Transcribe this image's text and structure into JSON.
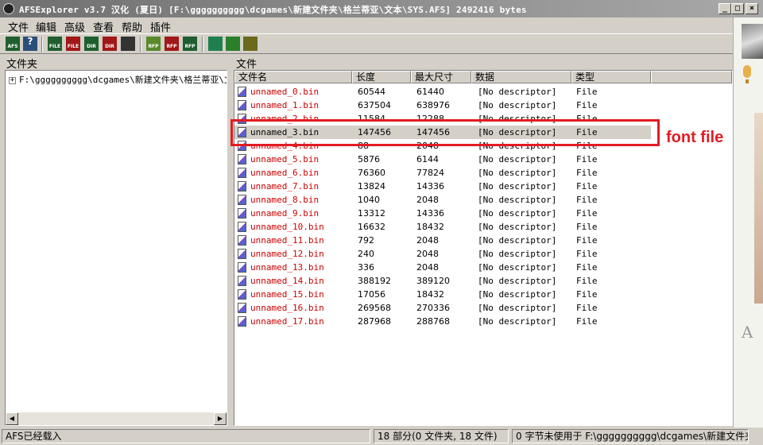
{
  "window": {
    "title": "AFSExplorer v3.7  汉化 (夏日) [F:\\gggggggggg\\dcgames\\新建文件夹\\格兰蒂亚\\文本\\SYS.AFS] 2492416 bytes",
    "min_glyph": "_",
    "max_glyph": "□",
    "close_glyph": "×"
  },
  "menu": [
    "文件",
    "编辑",
    "高级",
    "查看",
    "帮助",
    "插件"
  ],
  "toolbar": [
    {
      "icon": "afs-open-icon",
      "caption": "AFS",
      "color": "#1f5f2f"
    },
    {
      "icon": "help-icon",
      "caption": "?",
      "color": "#2a4f7a"
    },
    {
      "icon": "file-extract-icon",
      "caption": "FILE",
      "color": "#1f5f2f"
    },
    {
      "icon": "file-import-icon",
      "caption": "FILE",
      "color": "#a01818"
    },
    {
      "icon": "dir-extract-icon",
      "caption": "DIR",
      "color": "#1f5f2f"
    },
    {
      "icon": "dir-import-icon",
      "caption": "DIR",
      "color": "#a01818"
    },
    {
      "icon": "binoculars-icon",
      "caption": "",
      "color": "#333333"
    },
    {
      "icon": "rfp-build-icon",
      "caption": "RFP",
      "color": "#5a8a2a"
    },
    {
      "icon": "rfp-extract-icon",
      "caption": "RFP",
      "color": "#a01818"
    },
    {
      "icon": "rfp-import-icon",
      "caption": "RFP",
      "color": "#1f5f2f"
    },
    {
      "icon": "diamond-icon",
      "caption": "",
      "color": "#1f7f4f"
    },
    {
      "icon": "waveform-icon",
      "caption": "",
      "color": "#2a7f2a"
    },
    {
      "icon": "edit-icon",
      "caption": "",
      "color": "#6a6a1a"
    }
  ],
  "left_pane": {
    "label": "文件夹",
    "tree_item": "F:\\gggggggggg\\dcgames\\新建文件夹\\格兰蒂亚\\文",
    "expander": "+"
  },
  "right_pane": {
    "label": "文件",
    "columns": [
      "文件名",
      "长度",
      "最大尺寸",
      "数据",
      "类型"
    ],
    "rows": [
      {
        "name": "unnamed_0.bin",
        "length": "60544",
        "max": "61440",
        "data": "[No descriptor]",
        "type": "File"
      },
      {
        "name": "unnamed_1.bin",
        "length": "637504",
        "max": "638976",
        "data": "[No descriptor]",
        "type": "File"
      },
      {
        "name": "unnamed_2.bin",
        "length": "11584",
        "max": "12288",
        "data": "[No descriptor]",
        "type": "File"
      },
      {
        "name": "unnamed_3.bin",
        "length": "147456",
        "max": "147456",
        "data": "[No descriptor]",
        "type": "File"
      },
      {
        "name": "unnamed_4.bin",
        "length": "88",
        "max": "2048",
        "data": "[No descriptor]",
        "type": "File"
      },
      {
        "name": "unnamed_5.bin",
        "length": "5876",
        "max": "6144",
        "data": "[No descriptor]",
        "type": "File"
      },
      {
        "name": "unnamed_6.bin",
        "length": "76360",
        "max": "77824",
        "data": "[No descriptor]",
        "type": "File"
      },
      {
        "name": "unnamed_7.bin",
        "length": "13824",
        "max": "14336",
        "data": "[No descriptor]",
        "type": "File"
      },
      {
        "name": "unnamed_8.bin",
        "length": "1040",
        "max": "2048",
        "data": "[No descriptor]",
        "type": "File"
      },
      {
        "name": "unnamed_9.bin",
        "length": "13312",
        "max": "14336",
        "data": "[No descriptor]",
        "type": "File"
      },
      {
        "name": "unnamed_10.bin",
        "length": "16632",
        "max": "18432",
        "data": "[No descriptor]",
        "type": "File"
      },
      {
        "name": "unnamed_11.bin",
        "length": "792",
        "max": "2048",
        "data": "[No descriptor]",
        "type": "File"
      },
      {
        "name": "unnamed_12.bin",
        "length": "240",
        "max": "2048",
        "data": "[No descriptor]",
        "type": "File"
      },
      {
        "name": "unnamed_13.bin",
        "length": "336",
        "max": "2048",
        "data": "[No descriptor]",
        "type": "File"
      },
      {
        "name": "unnamed_14.bin",
        "length": "388192",
        "max": "389120",
        "data": "[No descriptor]",
        "type": "File"
      },
      {
        "name": "unnamed_15.bin",
        "length": "17056",
        "max": "18432",
        "data": "[No descriptor]",
        "type": "File"
      },
      {
        "name": "unnamed_16.bin",
        "length": "269568",
        "max": "270336",
        "data": "[No descriptor]",
        "type": "File"
      },
      {
        "name": "unnamed_17.bin",
        "length": "287968",
        "max": "288768",
        "data": "[No descriptor]",
        "type": "File"
      }
    ],
    "selected_index": 3
  },
  "annotation": {
    "text": "font file",
    "color": "#e31b23"
  },
  "status": {
    "left": "AFS已经载入",
    "middle": "18 部分(0 文件夹, 18 文件)",
    "right": "0 字节未使用于 F:\\gggggggggg\\dcgames\\新建文件夹\\"
  }
}
